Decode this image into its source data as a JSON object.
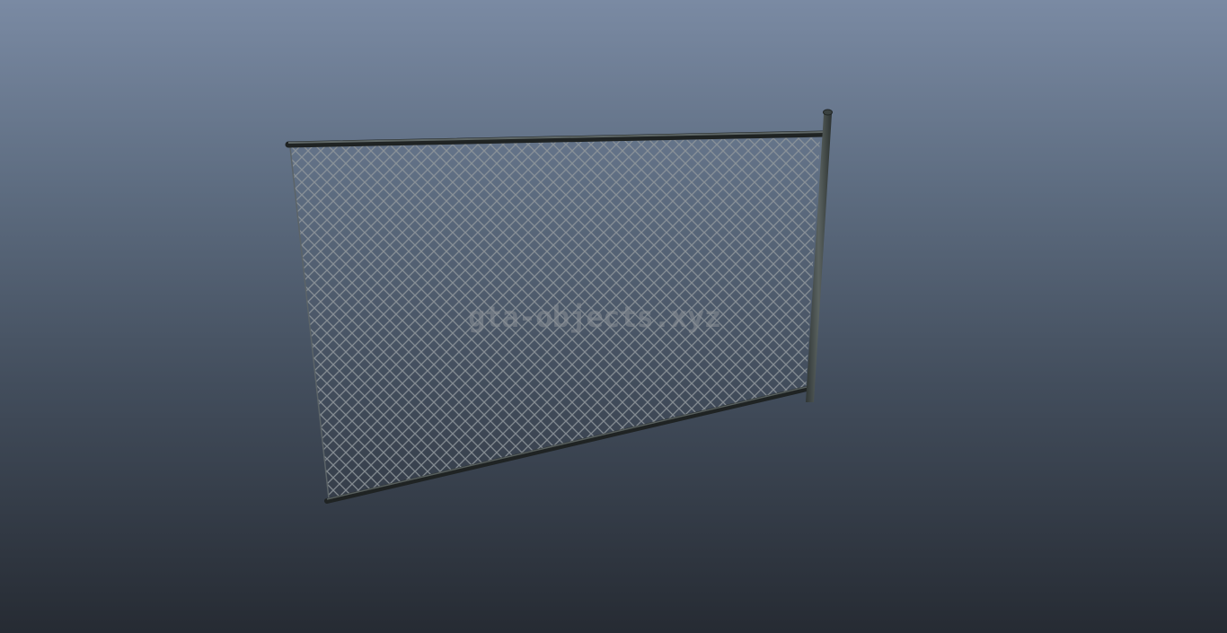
{
  "viewer": {
    "background_top": "#7a8aa3",
    "background_bottom": "#262b33"
  },
  "object": {
    "icon": "chain-link-fence-icon",
    "mesh_color": "#8a9196",
    "pole_color": "#4a5250",
    "rail_color": "#3a403f"
  },
  "watermark": {
    "text": "gta-objects.xyz"
  }
}
